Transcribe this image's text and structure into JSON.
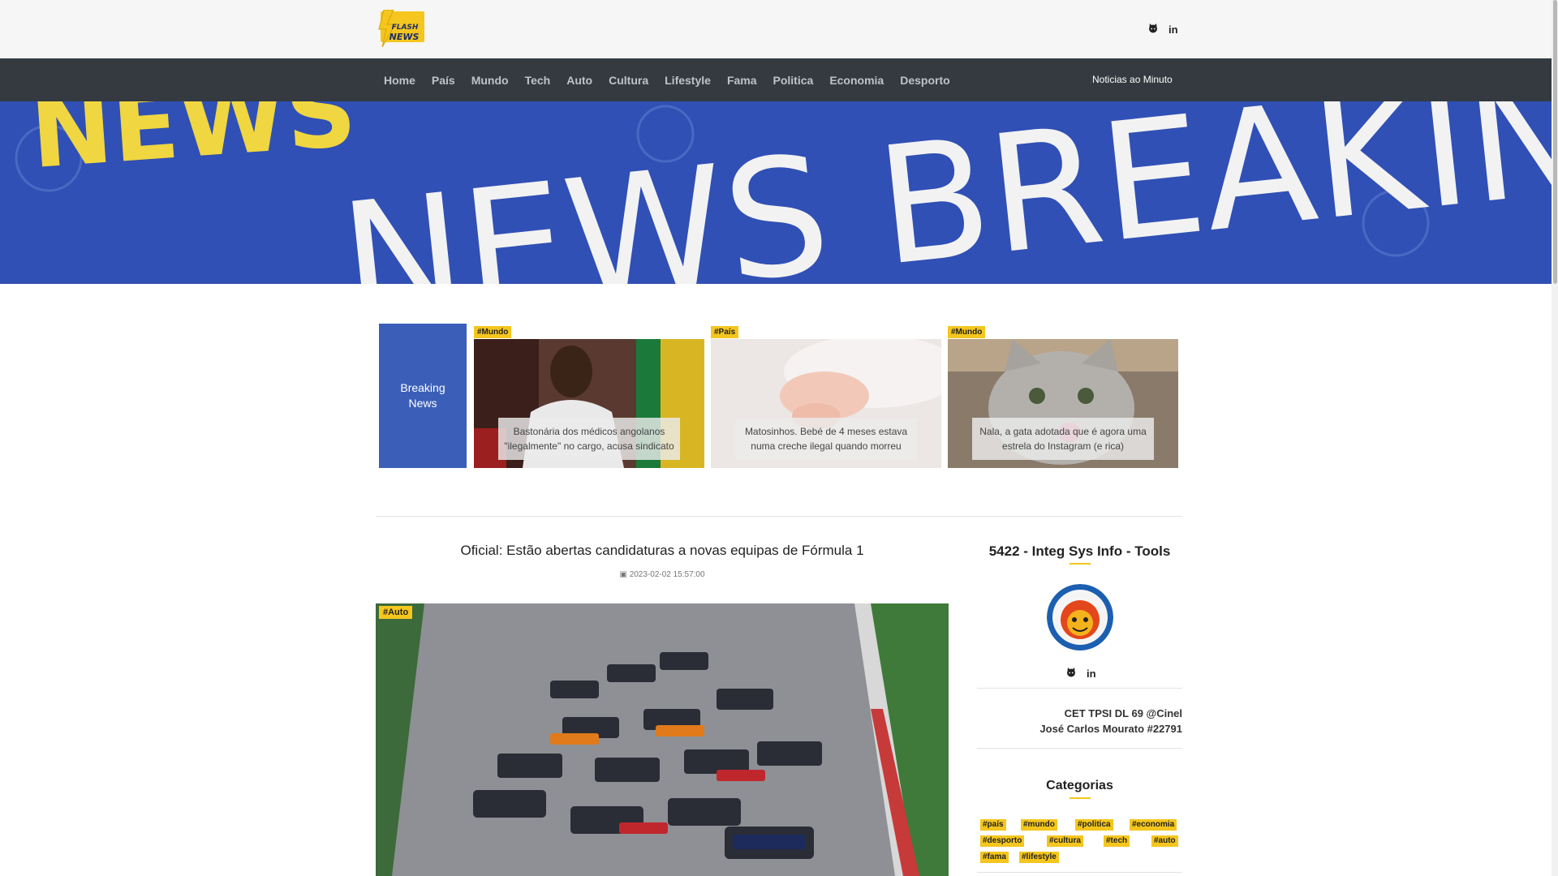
{
  "brand": {
    "logo_line1": "FLASH",
    "logo_line2": "NEWS"
  },
  "top_social": [
    {
      "icon": "github-icon"
    },
    {
      "icon": "linkedin-icon",
      "label": "in"
    }
  ],
  "nav": {
    "items": [
      "Home",
      "País",
      "Mundo",
      "Tech",
      "Auto",
      "Cultura",
      "Lifestyle",
      "Fama",
      "Politica",
      "Economia",
      "Desporto"
    ],
    "right": "Noticias ao Minuto"
  },
  "banner": {
    "text": "NEWS BREAKING NEWS"
  },
  "breaking": {
    "label": "Breaking News",
    "cards": [
      {
        "tag": "#Mundo",
        "caption": "Bastonária dos médicos angolanos \"ilegalmente\" no cargo, acusa sindicato"
      },
      {
        "tag": "#País",
        "caption": "Matosinhos. Bebé de 4 meses estava numa creche ilegal quando morreu"
      },
      {
        "tag": "#Mundo",
        "caption": "Nala, a gata adotada que é agora uma estrela do Instagram (e rica)"
      }
    ]
  },
  "article": {
    "title": "Oficial: Estão abertas candidaturas a novas equipas de Fórmula 1",
    "date": "2023-02-02 15:57:00",
    "tag": "#Auto"
  },
  "sidebar": {
    "title": "5422 - Integ Sys Info - Tools",
    "social": [
      {
        "icon": "github-icon"
      },
      {
        "icon": "linkedin-icon",
        "label": "in"
      }
    ],
    "info_line1": "CET TPSI DL 69 @Cinel",
    "info_line2": "José Carlos Mourato #22791",
    "categories_title": "Categorias",
    "categories": [
      "#país",
      "#mundo",
      "#politica",
      "#economia",
      "#desporto",
      "#cultura",
      "#tech",
      "#auto",
      "#fama",
      "#lifestyle"
    ]
  },
  "colors": {
    "accent": "#f4c61e",
    "nav_bg": "#343a40",
    "banner_bg": "#3050b5",
    "breaking_bg": "#3b5fb8"
  }
}
